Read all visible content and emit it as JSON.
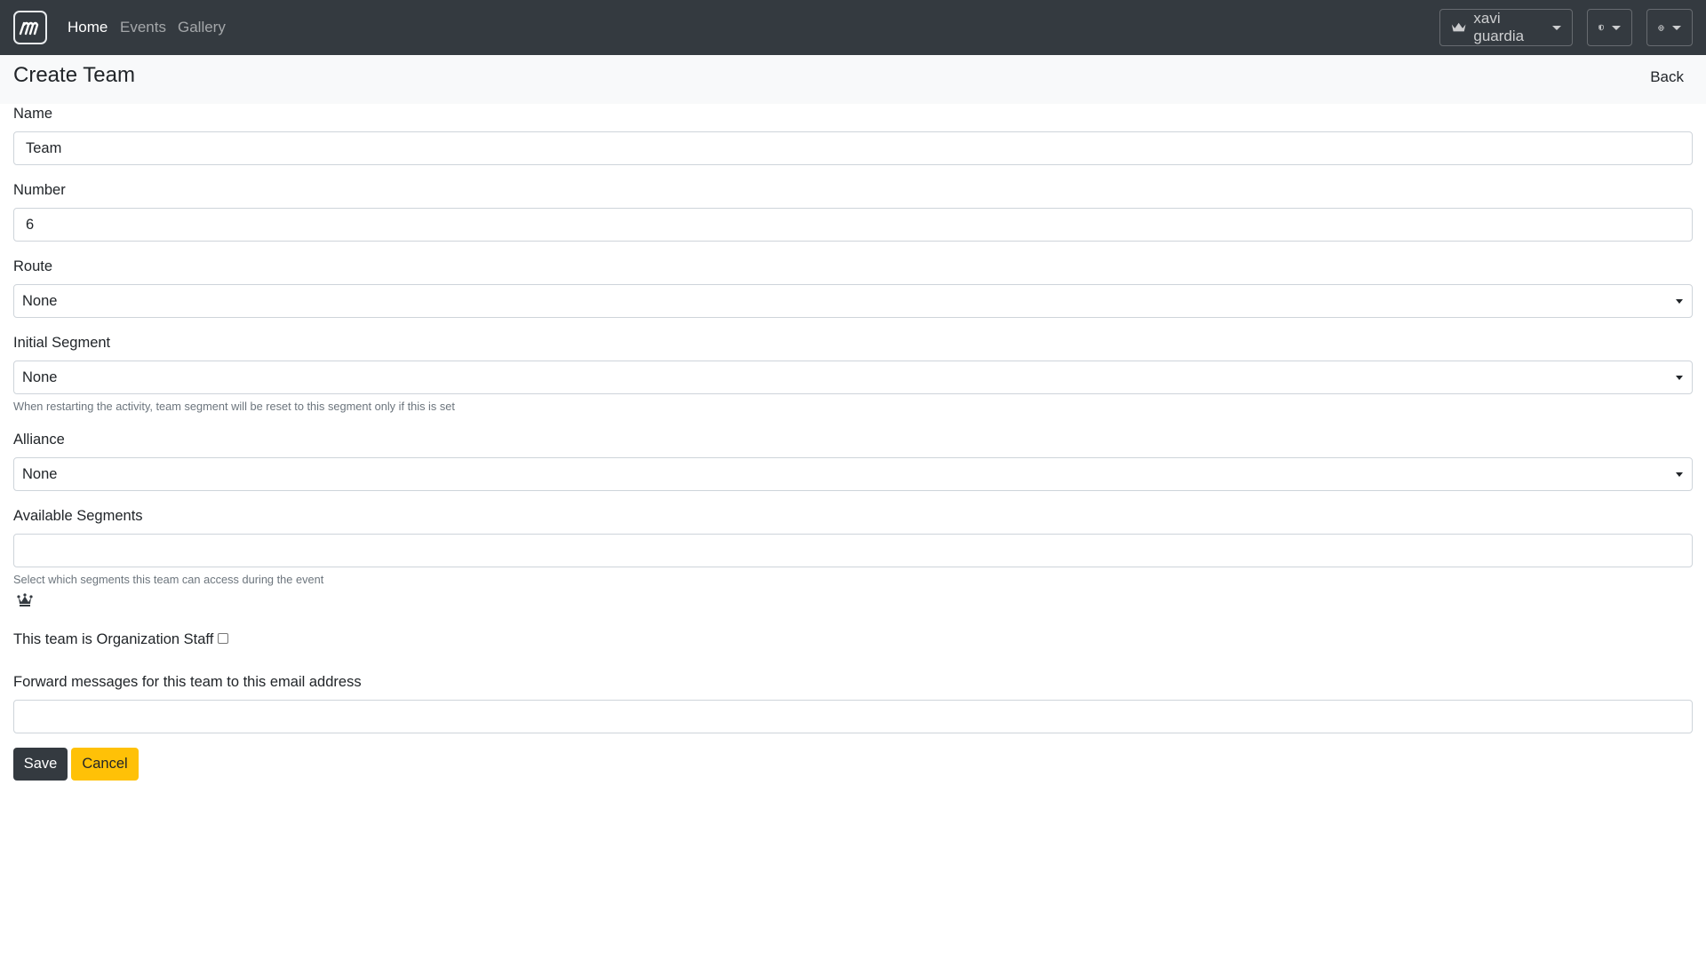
{
  "nav": {
    "links": [
      "Home",
      "Events",
      "Gallery"
    ],
    "user_label": "xavi guardia",
    "icons": [
      "logo-icon",
      "crown-icon",
      "shield-icon",
      "globe-icon"
    ]
  },
  "header": {
    "title": "Create Team",
    "back_label": "Back"
  },
  "form": {
    "name": {
      "label": "Name",
      "value": "Team"
    },
    "number": {
      "label": "Number",
      "value": "6"
    },
    "route": {
      "label": "Route",
      "value": "None"
    },
    "initial_segment": {
      "label": "Initial Segment",
      "value": "None",
      "help": "When restarting the activity, team segment will be reset to this segment only if this is set"
    },
    "alliance": {
      "label": "Alliance",
      "value": "None"
    },
    "available_segments": {
      "label": "Available Segments",
      "value": "",
      "help": "Select which segments this team can access during the event"
    },
    "org_staff": {
      "label": "This team is Organization Staff",
      "checked": false
    },
    "forward_email": {
      "label": "Forward messages for this team to this email address",
      "value": ""
    }
  },
  "buttons": {
    "save": "Save",
    "cancel": "Cancel"
  },
  "colors": {
    "navbar": "#343a40",
    "save_button": "#343a40",
    "cancel_button": "#ffc107",
    "header_strip": "#f8f9fa"
  }
}
